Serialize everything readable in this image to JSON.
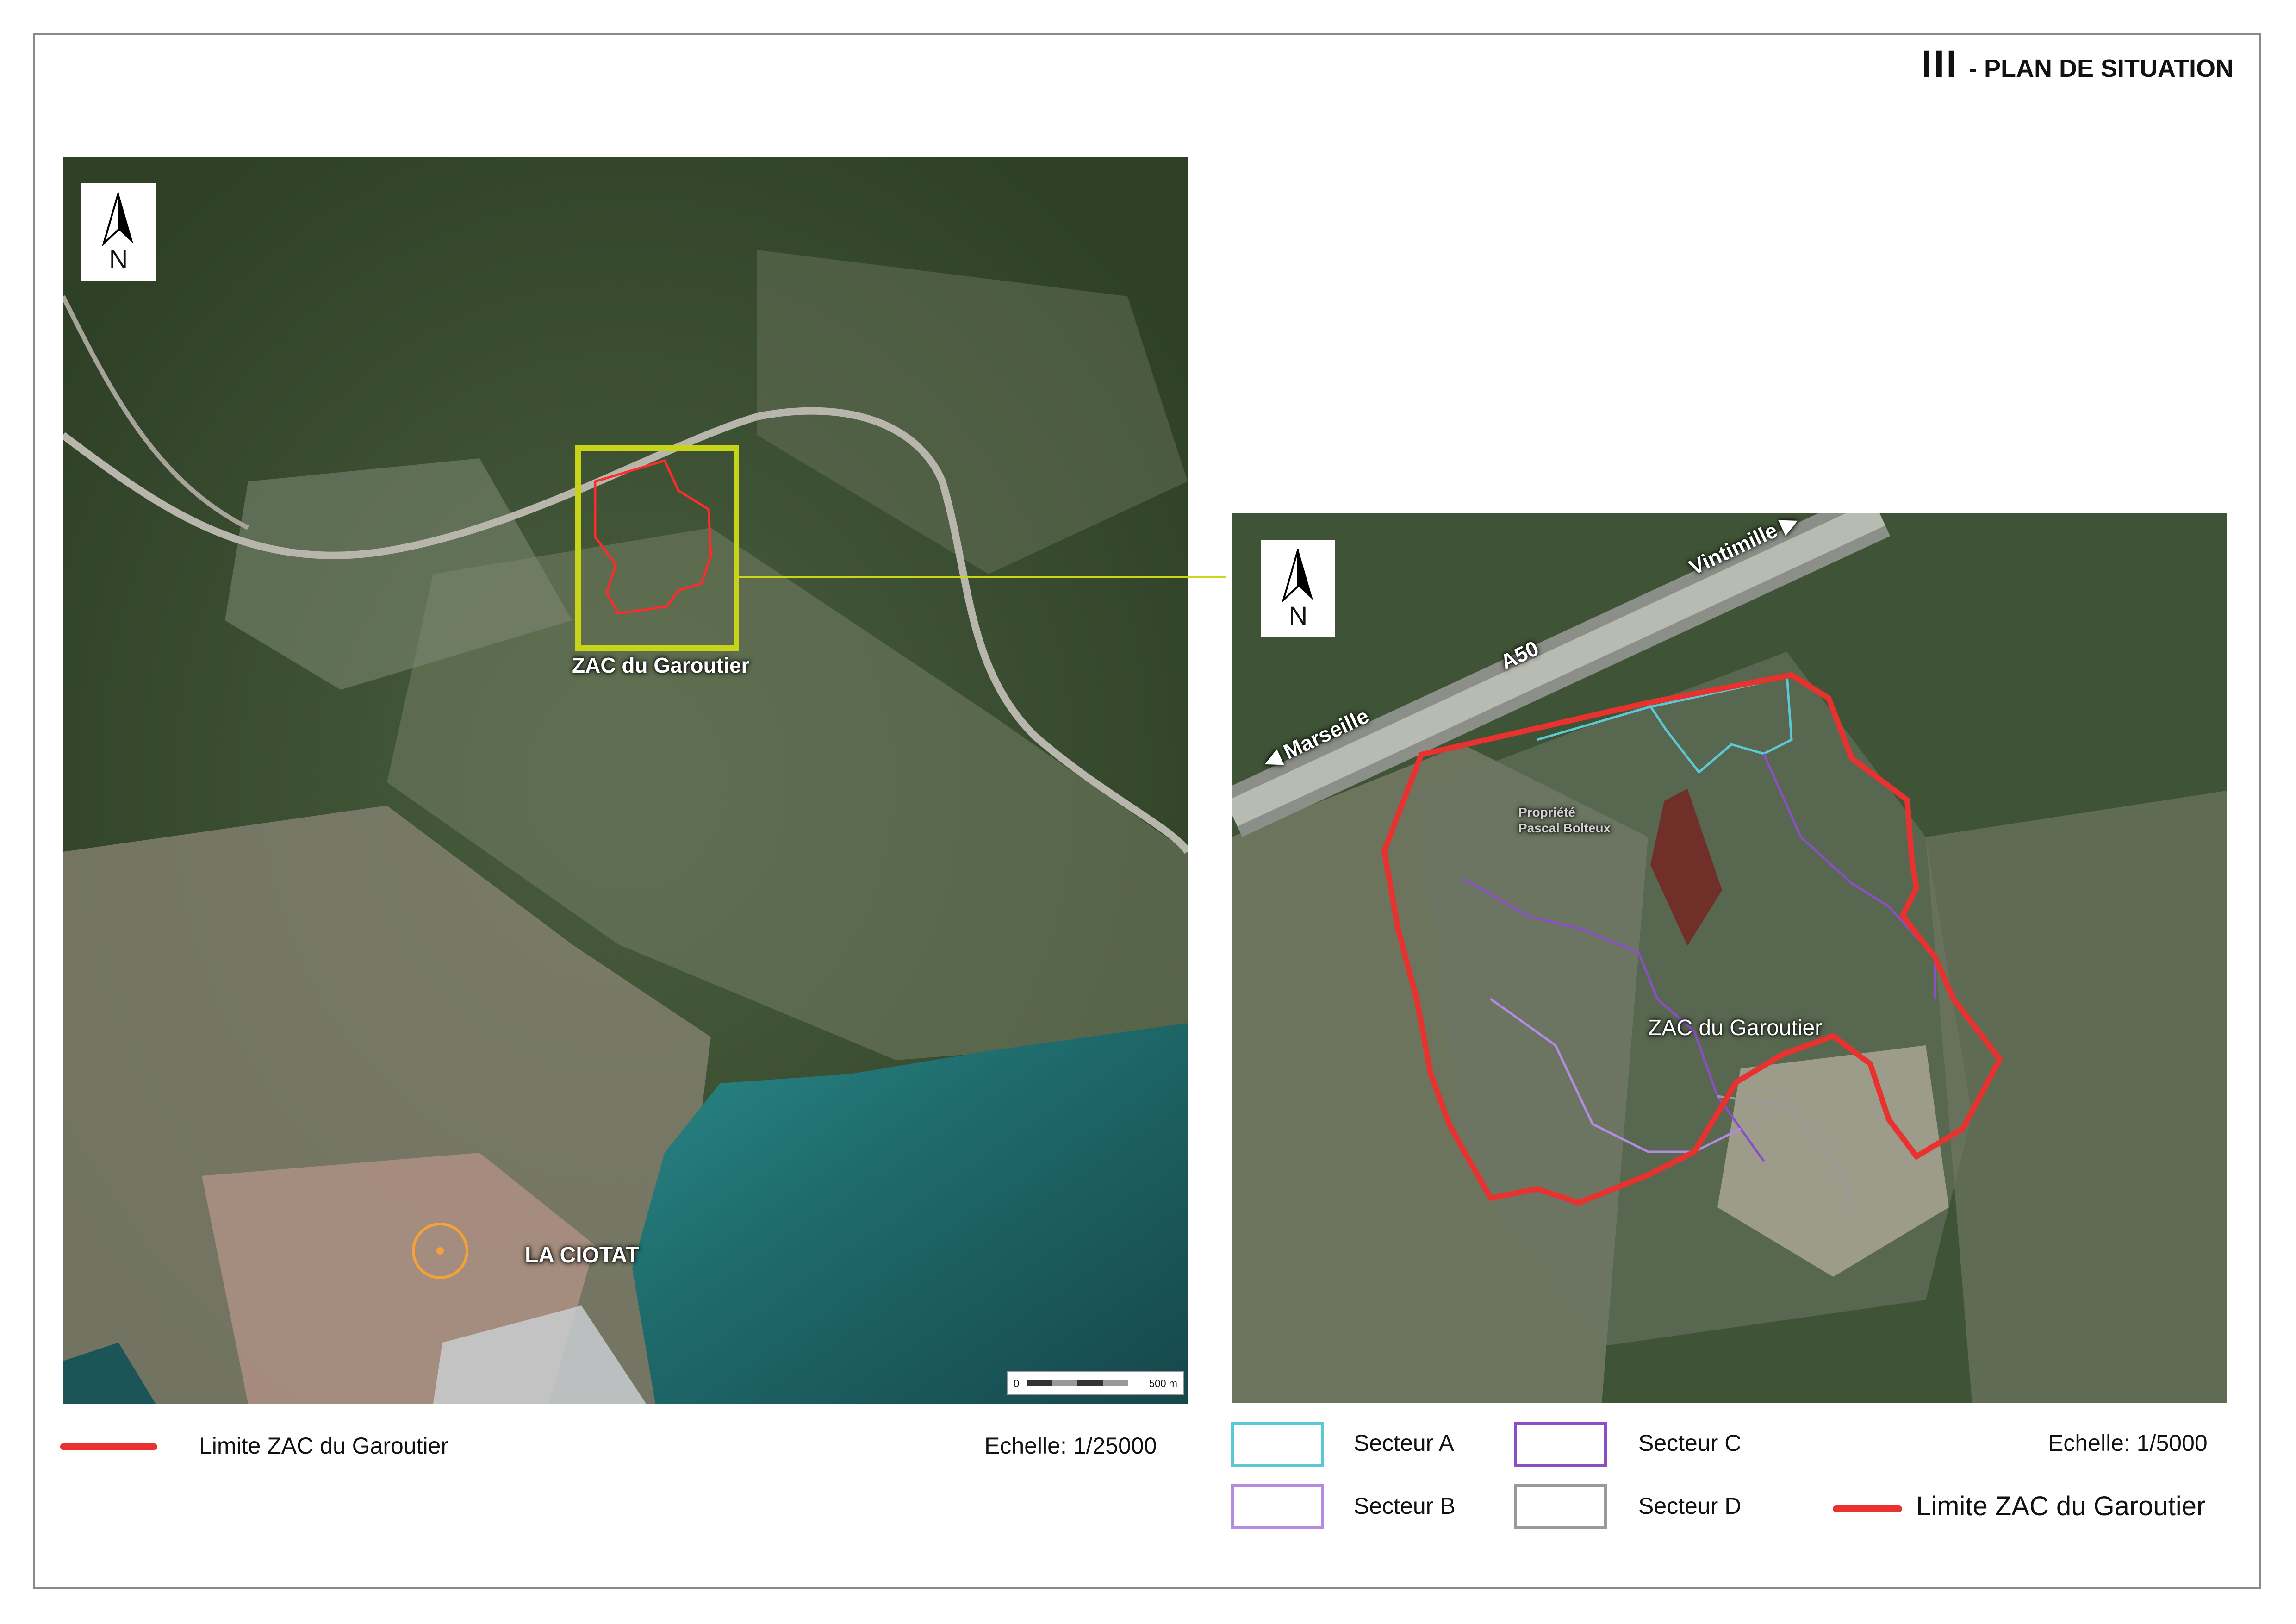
{
  "header": {
    "roman": "III",
    "title": "- PLAN DE SITUATION"
  },
  "map_left": {
    "compass_label": "N",
    "zac_label": "ZAC du Garoutier",
    "town_label": "LA CIOTAT",
    "scalebar": {
      "zero": "0",
      "max": "500 m"
    },
    "colors": {
      "zac_box": "#c8d41a",
      "zac_limit": "#ff2a2a",
      "sea": "#1d5f63",
      "land": "#3d5235"
    }
  },
  "map_right": {
    "compass_label": "N",
    "zac_label": "ZAC du Garoutier",
    "road_label": "A50",
    "dir_marseille": "Marseille",
    "dir_vintimille": "Vintimille",
    "property_line1": "Propriété",
    "property_line2": "Pascal Bolteux",
    "colors": {
      "limit": "#e8322f",
      "secteur_a": "#5cc8d6",
      "secteur_b": "#b38be0",
      "secteur_c": "#8a4fc4",
      "secteur_d": "#9a9a9a"
    }
  },
  "legend_left": {
    "limit_label": "Limite ZAC du Garoutier",
    "scale": "Echelle: 1/25000"
  },
  "legend_right": {
    "secteur_a": "Secteur A",
    "secteur_b": "Secteur B",
    "secteur_c": "Secteur C",
    "secteur_d": "Secteur D",
    "scale": "Echelle: 1/5000",
    "limit_label": "Limite ZAC du Garoutier"
  }
}
